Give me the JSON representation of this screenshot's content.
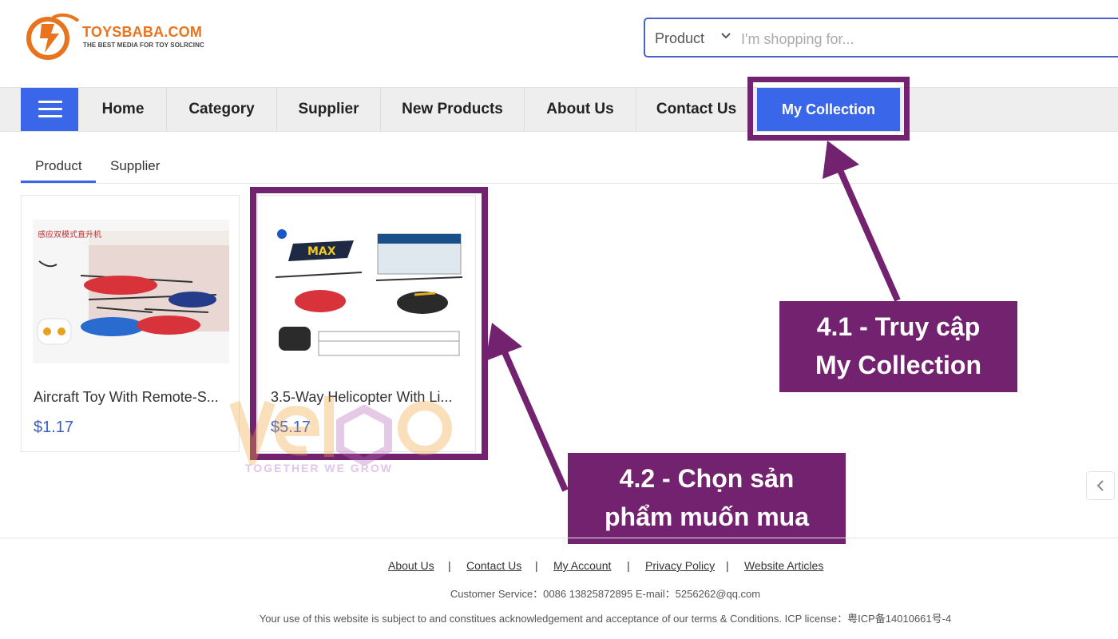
{
  "brand": {
    "name": "TOYSBABA.COM",
    "tagline": "THE BEST MEDIA FOR TOY SOLRCINC"
  },
  "search": {
    "category": "Product",
    "placeholder": "I'm shopping for..."
  },
  "nav": {
    "items": [
      "Home",
      "Category",
      "Supplier",
      "New Products",
      "About Us",
      "Contact Us"
    ],
    "active": "My Collection"
  },
  "tabs": [
    "Product",
    "Supplier"
  ],
  "products": [
    {
      "title": "Aircraft Toy With Remote-S...",
      "price": "$1.17"
    },
    {
      "title": "3.5-Way Helicopter With Li...",
      "price": "$5.17"
    }
  ],
  "annotations": {
    "step1_line1": "4.1 - Truy cập",
    "step1_line2": "My Collection",
    "step2_line1": "4.2 - Chọn sản",
    "step2_line2": "phẩm muốn mua"
  },
  "watermark": {
    "text": "TOGETHER WE GROW"
  },
  "footer": {
    "links": [
      "About Us",
      "Contact Us",
      "My Account",
      "Privacy Policy",
      "Website Articles"
    ],
    "service": "Customer Service：0086 13825872895   E-mail：5256262@qq.com",
    "terms": "Your use of this website is subject to and constitues acknowledgement and acceptance of our terms & Conditions. ICP license：粤ICP备14010661号-4"
  },
  "colors": {
    "accent": "#3a66e9",
    "annotation": "#72226e",
    "brand": "#e8741e",
    "price": "#3a5ec8"
  }
}
